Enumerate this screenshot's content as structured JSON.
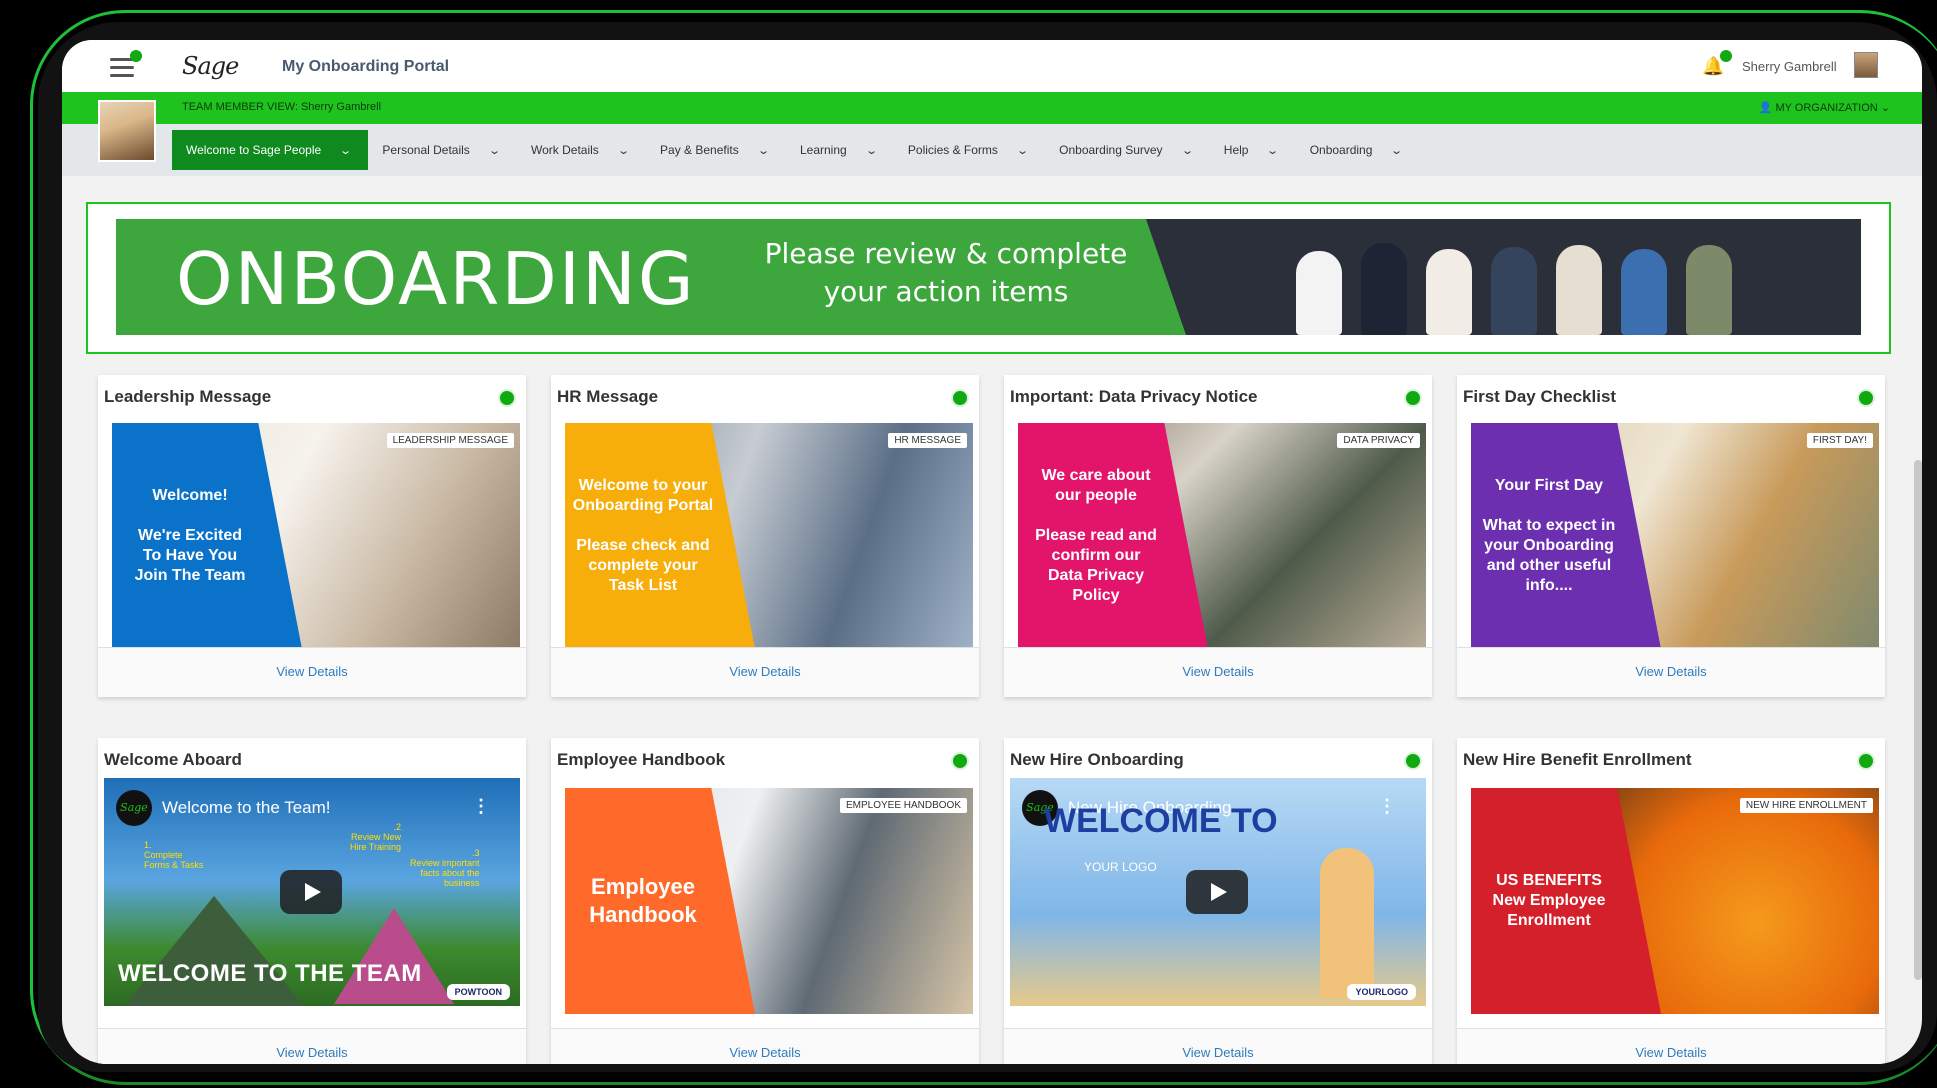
{
  "app": {
    "logo": "Sage",
    "portal_title": "My Onboarding Portal",
    "user_name": "Sherry Gambrell"
  },
  "greenbar": {
    "team_view": "TEAM MEMBER VIEW: Sherry Gambrell",
    "my_org": "MY ORGANIZATION"
  },
  "nav": [
    {
      "label": "Welcome to Sage People",
      "active": true
    },
    {
      "label": "Personal Details"
    },
    {
      "label": "Work Details"
    },
    {
      "label": "Pay & Benefits"
    },
    {
      "label": "Learning"
    },
    {
      "label": "Policies & Forms"
    },
    {
      "label": "Onboarding Survey"
    },
    {
      "label": "Help"
    },
    {
      "label": "Onboarding"
    }
  ],
  "banner": {
    "title": "ONBOARDING",
    "subtitle": "Please review & complete\nyour action items"
  },
  "cards": [
    {
      "title": "Leadership Message",
      "tag": "LEADERSHIP MESSAGE",
      "panel_text": "Welcome!\n\nWe're Excited\nTo Have You\nJoin The Team",
      "panel_color": "#0a72c9",
      "footer": "View Details"
    },
    {
      "title": "HR Message",
      "tag": "HR MESSAGE",
      "panel_text": "Welcome to your\nOnboarding Portal\n\nPlease check and\ncomplete your\nTask List",
      "panel_color": "#f7ae0b",
      "footer": "View Details"
    },
    {
      "title": "Important: Data Privacy Notice",
      "tag": "DATA PRIVACY",
      "panel_text": "We care about\nour people\n\nPlease read and\nconfirm our\nData Privacy\nPolicy",
      "panel_color": "#e2156b",
      "footer": "View Details"
    },
    {
      "title": "First Day Checklist",
      "tag": "FIRST DAY!",
      "panel_text": "Your First Day\n\nWhat to expect in\nyour Onboarding\nand other useful\ninfo....",
      "panel_color": "#6b2fb0",
      "footer": "View Details"
    },
    {
      "title": "Welcome Aboard",
      "video_title": "Welcome to the Team!",
      "video_logo": "Sage",
      "bottom_text": "WELCOME TO THE TEAM",
      "badge": "POWTOON",
      "steps": [
        "1.\nComplete\nForms & Tasks",
        ".2\nReview New\nHire Training",
        ".3\nReview important\nfacts about the\nbusiness"
      ],
      "footer": "View Details"
    },
    {
      "title": "Employee Handbook",
      "tag": "EMPLOYEE HANDBOOK",
      "panel_text": "Employee\nHandbook",
      "panel_color": "#ff6a2b",
      "footer": "View Details"
    },
    {
      "title": "New Hire Onboarding",
      "video_title": "New Hire Onboarding",
      "video_logo": "Sage",
      "big_text": "WELCOME TO",
      "logo_text": "YOUR LOGO",
      "badge": "YOURLOGO",
      "footer": "View Details"
    },
    {
      "title": "New Hire Benefit Enrollment",
      "tag": "NEW HIRE ENROLLMENT",
      "panel_text": "US BENEFITS\nNew Employee\nEnrollment",
      "panel_color": "#d4202a",
      "footer": "View Details"
    }
  ],
  "colors": {
    "brand_green": "#1ec31e",
    "nav_active": "#0f8a1f",
    "link_blue": "#2f7bbd"
  }
}
